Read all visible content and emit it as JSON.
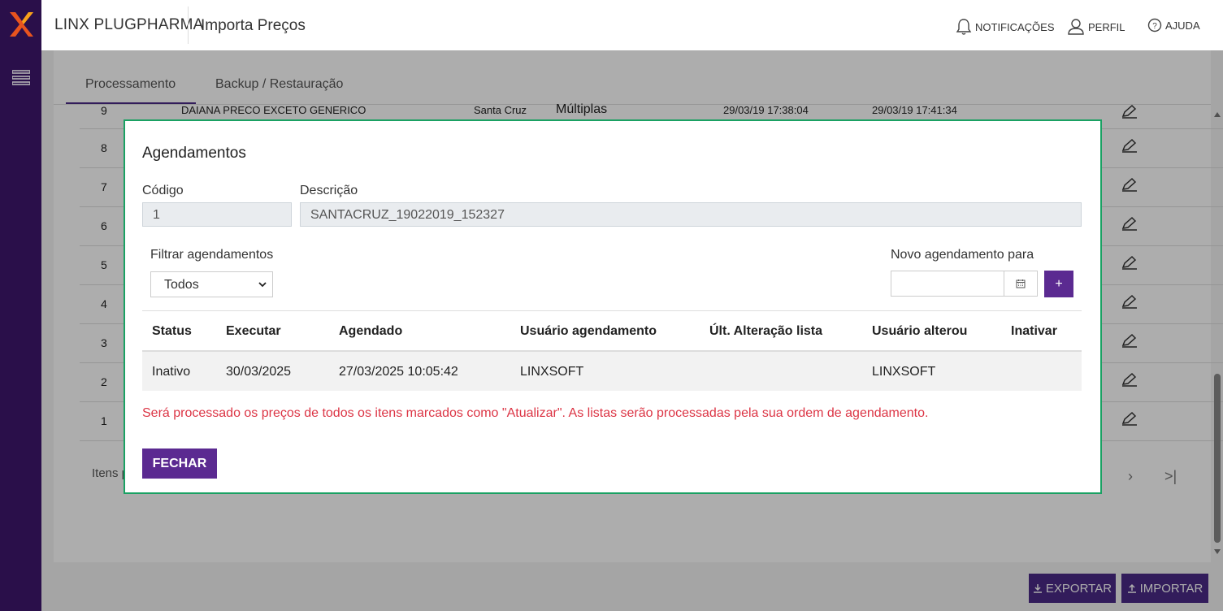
{
  "app": {
    "brand": "LINX PLUGPHARMA",
    "page_title": "Importa Preços"
  },
  "header_actions": [
    {
      "label": "NOTIFICAÇÕES",
      "icon": "bell-icon"
    },
    {
      "label": "PERFIL",
      "icon": "user-icon"
    },
    {
      "label": "AJUDA",
      "icon": "help-icon"
    }
  ],
  "tabs": [
    {
      "label": "Processamento",
      "active": true
    },
    {
      "label": "Backup / Restauração",
      "active": false
    }
  ],
  "background_table": {
    "first_row": {
      "num": "9",
      "name": "DAIANA PRECO EXCETO GENERICO",
      "loja": "Santa Cruz",
      "tipo": "Múltiplas",
      "inicio": "29/03/19 17:38:04",
      "fim": "29/03/19 17:41:34"
    },
    "rows": [
      "8",
      "7",
      "6",
      "5",
      "4",
      "3",
      "2",
      "1"
    ]
  },
  "pagination": {
    "label": "Itens po",
    "next": "›",
    "last": ">|"
  },
  "footer": {
    "export_label": "EXPORTAR",
    "import_label": "IMPORTAR"
  },
  "modal": {
    "title": "Agendamentos",
    "codigo_label": "Código",
    "codigo_value": "1",
    "descricao_label": "Descrição",
    "descricao_value": "SANTACRUZ_19022019_152327",
    "filter_label": "Filtrar agendamentos",
    "filter_value": "Todos",
    "novo_label": "Novo agendamento para",
    "novo_value": "",
    "add_label": "+",
    "columns": [
      "Status",
      "Executar",
      "Agendado",
      "Usuário agendamento",
      "Últ. Alteração lista",
      "Usuário alterou",
      "Inativar"
    ],
    "rows": [
      [
        "Inativo",
        "30/03/2025",
        "27/03/2025 10:05:42",
        "LINXSOFT",
        "",
        "LINXSOFT",
        ""
      ]
    ],
    "note": "Será processado os preços de todos os itens marcados como \"Atualizar\". As listas serão processadas pela sua ordem de agendamento.",
    "close_label": "FECHAR"
  },
  "colors": {
    "sidebar": "#2a0f4a",
    "primary": "#5b2a91",
    "modal_border": "#1aa163",
    "note": "#dc3545"
  }
}
